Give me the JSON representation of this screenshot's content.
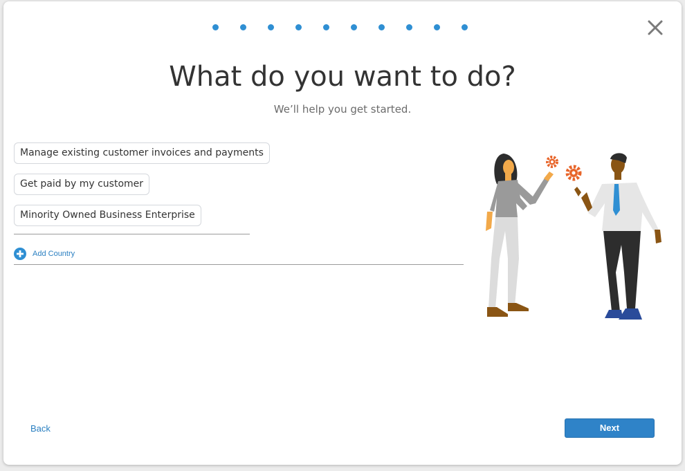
{
  "colors": {
    "accent": "#2f8fd3",
    "link": "#2a7fc1",
    "primary_button": "#2f83c8",
    "title_text": "#333333",
    "subtitle_text": "#6b6b6b"
  },
  "progress": {
    "total_steps": 10
  },
  "icons": {
    "close": "close-icon",
    "add": "plus-circle-icon"
  },
  "header": {
    "title": "What do you want to do?",
    "subtitle": "We’ll help you get started."
  },
  "options": [
    {
      "label": "Manage existing customer invoices and payments"
    },
    {
      "label": "Get paid by my customer"
    },
    {
      "label": "Minority Owned Business Enterprise"
    }
  ],
  "add_country": {
    "label": "Add Country"
  },
  "footer": {
    "back_label": "Back",
    "next_label": "Next"
  }
}
